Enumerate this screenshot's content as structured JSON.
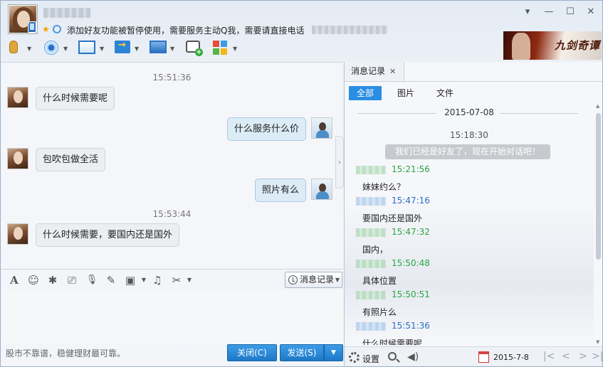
{
  "window": {
    "status_message": "添加好友功能被暂停使用，需要服务主动Q我，需要请直接电话",
    "controls": {
      "menu": "▾",
      "minimize": "—",
      "maximize": "☐",
      "close": "✕"
    },
    "ad_logo": "九剑奇谭"
  },
  "toolbar": {
    "items": [
      "voice-call",
      "video-call",
      "screen-share",
      "send-file",
      "remote-assist",
      "create-discussion",
      "apps"
    ]
  },
  "chat": {
    "messages": [
      {
        "timestamp": "15:51:36"
      },
      {
        "from": "peer",
        "text": "什么时候需要呢"
      },
      {
        "from": "self",
        "text": "什么服务什么价"
      },
      {
        "from": "peer",
        "text": "包吹包做全活"
      },
      {
        "from": "self",
        "text": "照片有么"
      },
      {
        "timestamp": "15:53:44"
      },
      {
        "from": "peer",
        "text": "什么时候需要，要国内还是国外"
      }
    ]
  },
  "input_toolbar": {
    "font": "A",
    "emoji": "☺",
    "shake": "✱",
    "screenshot": "⎚",
    "voice_msg": "🎙",
    "note": "✎",
    "image": "▣",
    "music": "♫",
    "scissors": "✂",
    "history_label": "消息记录"
  },
  "bottom": {
    "tip": "股市不靠谱，稳健理财最可靠。",
    "close_label": "关闭(C)",
    "send_label": "发送(S)",
    "send_dropdown": "▼"
  },
  "history": {
    "tab_label": "消息记录",
    "tab_close": "✕",
    "filters": {
      "all": "全部",
      "images": "图片",
      "files": "文件"
    },
    "date": "2015-07-08",
    "first_time": "15:18:30",
    "system_message": "我们已经是好友了，现在开始对话吧！",
    "entries": [
      {
        "side": "peer",
        "time": "15:21:56",
        "text": "妹妹约么？"
      },
      {
        "side": "self",
        "time": "15:47:16",
        "text": "要国内还是国外"
      },
      {
        "side": "peer",
        "time": "15:47:32",
        "text": "国内，"
      },
      {
        "side": "peer",
        "time": "15:50:48",
        "text": "具体位置"
      },
      {
        "side": "peer",
        "time": "15:50:51",
        "text": "有照片么"
      },
      {
        "side": "self",
        "time": "15:51:36",
        "text": "什么时候需要呢"
      }
    ],
    "footer": {
      "settings_label": "设置",
      "calendar_date": "2015-7-8",
      "pager": {
        "first": "|<",
        "prev": "<",
        "next": ">",
        "last": ">|"
      }
    }
  },
  "colors": {
    "accent": "#2a8ee2",
    "peer_time": "#2aa442",
    "self_time": "#2a6ec4",
    "send_button": "#1d79c8"
  }
}
